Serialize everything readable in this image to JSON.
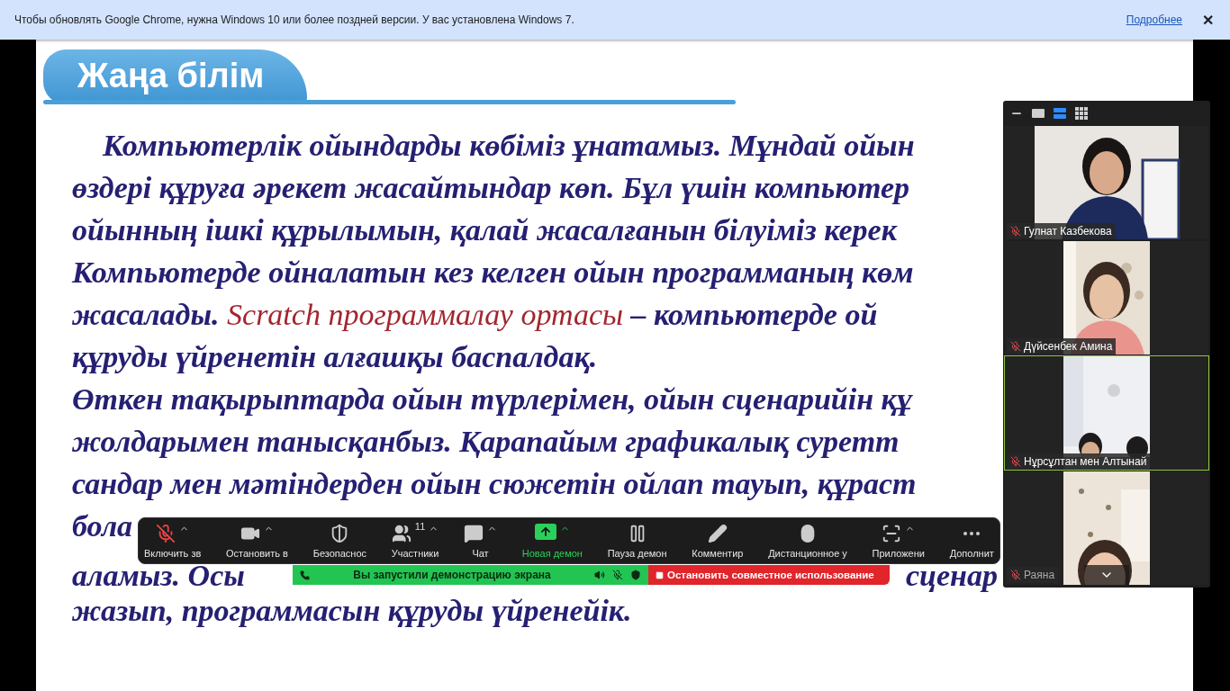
{
  "browser_infobar": {
    "message": "Чтобы обновлять Google Chrome, нужна Windows 10 или более поздней версии. У вас установлена Windows 7.",
    "link": "Подробнее",
    "close": "✕"
  },
  "document": {
    "heading": "Жаңа білім",
    "lines": [
      {
        "indent": true,
        "parts": [
          {
            "text": "Компьютерлік ойындарды көбіміз ұнатамыз. Мұндай ойын",
            "highlight": false
          }
        ]
      },
      {
        "indent": false,
        "parts": [
          {
            "text": "өздері құруға әрекет жасайтындар көп. Бұл үшін компьютер",
            "highlight": false
          }
        ]
      },
      {
        "indent": false,
        "parts": [
          {
            "text": "ойынның ішкі құрылымын, қалай жасалғанын білуіміз керек",
            "highlight": false
          }
        ]
      },
      {
        "indent": false,
        "parts": [
          {
            "text": "Компьютерде ойналатын кез келген ойын программаның көм",
            "highlight": false
          }
        ]
      },
      {
        "indent": false,
        "parts": [
          {
            "text": "жасалады. ",
            "highlight": false
          },
          {
            "text": "Scratch программалау ортасы",
            "highlight": true
          },
          {
            "text": " – компьютерде ой",
            "highlight": false
          }
        ]
      },
      {
        "indent": false,
        "parts": [
          {
            "text": "құруды үйренетін алғашқы баспалдақ.",
            "highlight": false
          }
        ]
      },
      {
        "indent": false,
        "parts": [
          {
            "text": "Өткен тақырыптарда ойын түрлерімен, ойын сценарийін құ",
            "highlight": false
          }
        ]
      },
      {
        "indent": false,
        "parts": [
          {
            "text": "жолдарымен танысқанбыз. Қарапайым графикалық суретт",
            "highlight": false
          }
        ]
      },
      {
        "indent": false,
        "parts": [
          {
            "text": "сандар мен мәтіндерден ойын сюжетін ойлап тауып, құраст",
            "highlight": false
          }
        ]
      },
      {
        "indent": false,
        "parts": [
          {
            "text": "бола",
            "highlight": false
          }
        ]
      },
      {
        "indent": false,
        "fragments": [
          "аламыз. Осы",
          "сценар"
        ]
      },
      {
        "indent": false,
        "parts": [
          {
            "text": "жазып, программасын құруды үйренейік.",
            "highlight": false
          }
        ]
      }
    ]
  },
  "toolbar": {
    "items": [
      {
        "kind": "mic",
        "label": "Включить зв",
        "caret": true,
        "muted": true,
        "highlighted": false
      },
      {
        "kind": "video",
        "label": "Остановить в",
        "caret": true,
        "highlighted": false
      },
      {
        "kind": "security",
        "label": "Безопаснос",
        "caret": false,
        "highlighted": false
      },
      {
        "kind": "participants",
        "label": "Участники",
        "caret": true,
        "count": "11",
        "highlighted": false
      },
      {
        "kind": "chat",
        "label": "Чат",
        "caret": true,
        "highlighted": false
      },
      {
        "kind": "share",
        "label": "Новая демон",
        "caret": true,
        "highlighted": true
      },
      {
        "kind": "pause",
        "label": "Пауза демон",
        "caret": false,
        "highlighted": false
      },
      {
        "kind": "annotate",
        "label": "Комментир",
        "caret": false,
        "highlighted": false
      },
      {
        "kind": "remote",
        "label": "Дистанционное у",
        "caret": false,
        "highlighted": false
      },
      {
        "kind": "apps",
        "label": "Приложени",
        "caret": true,
        "highlighted": false
      },
      {
        "kind": "more",
        "label": "Дополнит",
        "caret": false,
        "highlighted": false
      }
    ]
  },
  "share_bar": {
    "status": "Вы запустили демонстрацию экрана",
    "stop": "Остановить совместное использование"
  },
  "video_panel": {
    "view_modes": [
      {
        "kind": "minimize",
        "selected": false
      },
      {
        "kind": "thumbnail",
        "selected": false
      },
      {
        "kind": "speaker",
        "selected": true
      },
      {
        "kind": "gallery",
        "selected": false
      }
    ],
    "tiles": [
      {
        "name": "Гулнат Казбекова",
        "muted": true,
        "active": false,
        "kind": "picture",
        "dim": false
      },
      {
        "name": "Дүйсенбек Амина",
        "muted": true,
        "active": false,
        "kind": "picture",
        "dim": false
      },
      {
        "name": "Нұрсұлтан мен Алтынай",
        "muted": true,
        "active": true,
        "kind": "picture",
        "dim": false
      },
      {
        "name": "Раяна",
        "muted": true,
        "active": false,
        "kind": "picture",
        "dim": true
      }
    ]
  }
}
